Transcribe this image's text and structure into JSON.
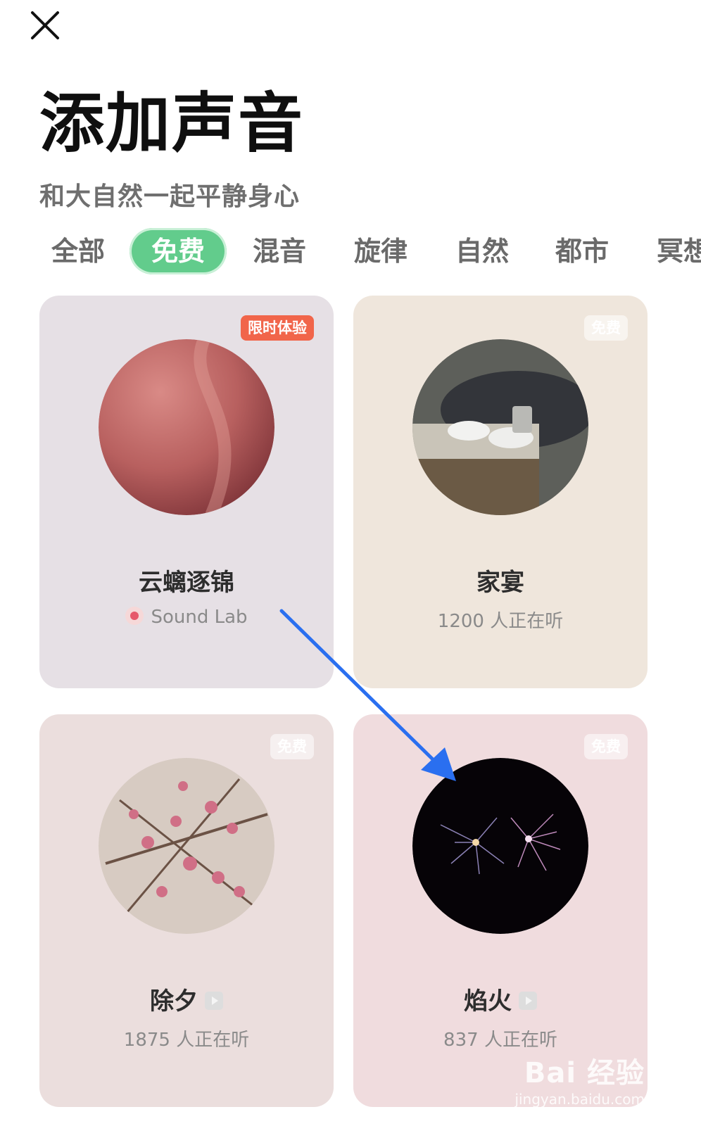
{
  "header": {
    "title": "添加声音",
    "subtitle": "和大自然一起平静身心"
  },
  "tabs": [
    {
      "label": "全部",
      "active": false
    },
    {
      "label": "免费",
      "active": true
    },
    {
      "label": "混音",
      "active": false
    },
    {
      "label": "旋律",
      "active": false
    },
    {
      "label": "自然",
      "active": false
    },
    {
      "label": "都市",
      "active": false
    },
    {
      "label": "冥想",
      "active": false
    }
  ],
  "cards": [
    {
      "name": "云螭逐锦",
      "badge": "限时体验",
      "meta": "Sound Lab",
      "bg": "#e6e0e5",
      "art_colors": [
        "#c9706f",
        "#8a3a3f"
      ]
    },
    {
      "name": "家宴",
      "badge": "免费",
      "meta": "1200 人正在听",
      "bg": "#efe6dc",
      "art_colors": [
        "#8b8d88",
        "#3a3a33"
      ]
    },
    {
      "name": "除夕",
      "badge": "免费",
      "meta": "1875 人正在听",
      "bg": "#ebdedd",
      "art_colors": [
        "#d7c7bf",
        "#c97f8f"
      ]
    },
    {
      "name": "焰火",
      "badge": "免费",
      "meta": "837 人正在听",
      "bg": "#f0dcde",
      "art_colors": [
        "#070308",
        "#6a5a8f"
      ]
    }
  ],
  "watermark": {
    "main": "Bai 经验",
    "sub": "jingyan.baidu.com"
  },
  "colors": {
    "accent": "#62cc8c",
    "trial_badge": "#f1654a",
    "annotation_arrow": "#2a6ff0"
  }
}
